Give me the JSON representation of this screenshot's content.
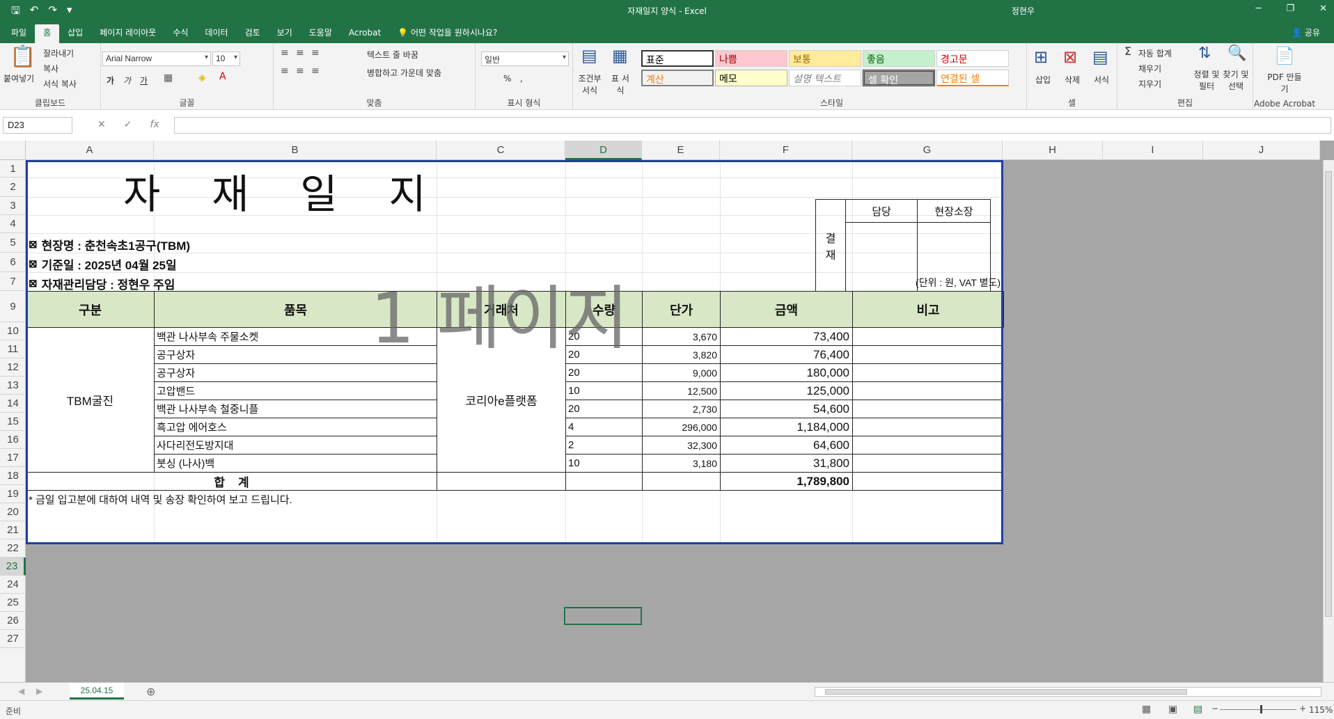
{
  "window": {
    "title": "자재일지 양식  -  Excel",
    "user": "정현우"
  },
  "qat": {
    "save": "🖫",
    "undo": "↶",
    "redo": "↷",
    "more": "▾"
  },
  "tabs": [
    "파일",
    "홈",
    "삽입",
    "페이지 레이아웃",
    "수식",
    "데이터",
    "검토",
    "보기",
    "도움말",
    "Acrobat"
  ],
  "tab_active": "홈",
  "tellme": "어떤 작업을 원하시나요?",
  "share": "공유",
  "ribbon": {
    "clipboard": {
      "paste": "붙여넣기",
      "cut": "잘라내기",
      "copy": "복사",
      "format_painter": "서식 복사",
      "label": "클립보드"
    },
    "font": {
      "name": "Arial Narrow",
      "size": "10",
      "bold": "가",
      "italic": "가",
      "underline": "가",
      "label": "글꼴"
    },
    "align": {
      "wrap": "텍스트 줄 바꿈",
      "merge": "병합하고 가운데 맞춤",
      "label": "맞춤"
    },
    "number": {
      "format": "일반",
      "percent": "%",
      "comma": ",",
      "label": "표시 형식"
    },
    "cond": {
      "conditional": "조건부 서식",
      "table": "표 서식"
    },
    "styles": {
      "label": "스타일",
      "items": [
        "표준",
        "나쁨",
        "보통",
        "좋음",
        "경고문",
        "계산",
        "메모",
        "설명 텍스트",
        "셀 확인",
        "연결된 셀"
      ]
    },
    "cells": {
      "insert": "삽입",
      "delete": "삭제",
      "format": "서식",
      "label": "셀"
    },
    "editing": {
      "autosum": "자동 합계",
      "fill": "채우기",
      "clear": "지우기",
      "sort": "정렬 및 필터",
      "find": "찾기 및 선택",
      "label": "편집"
    },
    "acrobat": {
      "pdf": "PDF 만들기",
      "label": "Adobe Acrobat"
    }
  },
  "namebox": "D23",
  "columns": [
    "A",
    "B",
    "C",
    "D",
    "E",
    "F",
    "G",
    "H",
    "I",
    "J"
  ],
  "rows": [
    "1",
    "2",
    "3",
    "4",
    "5",
    "6",
    "7",
    "9",
    "10",
    "11",
    "12",
    "13",
    "14",
    "15",
    "16",
    "17",
    "18",
    "19",
    "20",
    "21",
    "22",
    "23",
    "24",
    "25",
    "26",
    "27"
  ],
  "sheet": {
    "title": "자    재    일    지",
    "approval": {
      "label": "결\n재",
      "col1": "담당",
      "col2": "현장소장"
    },
    "info": [
      "현장명 : 춘천속초1공구(TBM)",
      "기준일 : 2025년 04월 25일",
      "자재관리담당 : 정현우 주임"
    ],
    "info_marker": "⊠",
    "unit": "(단위 : 원, VAT 별도)",
    "watermark": "1 페이지",
    "headers": [
      "구분",
      "품목",
      "거래처",
      "수량",
      "단가",
      "금액",
      "비고"
    ],
    "category": "TBM굴진",
    "vendor": "코리아e플랫폼",
    "items": [
      {
        "name": "백관 나사부속 주물소켓",
        "qty": "20",
        "price": "3,670",
        "amount": "73,400"
      },
      {
        "name": "공구상자",
        "qty": "20",
        "price": "3,820",
        "amount": "76,400"
      },
      {
        "name": "공구상자",
        "qty": "20",
        "price": "9,000",
        "amount": "180,000"
      },
      {
        "name": "고압밴드",
        "qty": "10",
        "price": "12,500",
        "amount": "125,000"
      },
      {
        "name": "백관 나사부속 철중니플",
        "qty": "20",
        "price": "2,730",
        "amount": "54,600"
      },
      {
        "name": "흑고압 에어호스",
        "qty": "4",
        "price": "296,000",
        "amount": "1,184,000"
      },
      {
        "name": "사다리전도방지대",
        "qty": "2",
        "price": "32,300",
        "amount": "64,600"
      },
      {
        "name": "붓싱 (나사)백",
        "qty": "10",
        "price": "3,180",
        "amount": "31,800"
      }
    ],
    "total_label": "합    계",
    "total": "1,789,800",
    "note": "* 금일 입고분에 대하여 내역 및 송장 확인하여 보고 드립니다."
  },
  "sheet_tab": "25.04.15",
  "status": {
    "ready": "준비",
    "zoom": "115%"
  }
}
